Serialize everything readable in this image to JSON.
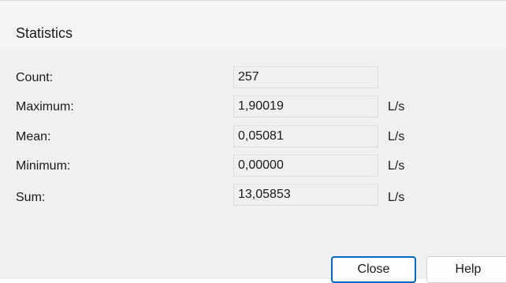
{
  "window": {
    "title": "Statistics"
  },
  "stats": [
    {
      "label": "Count:",
      "value": "257",
      "unit": ""
    },
    {
      "label": "Maximum:",
      "value": "1,90019",
      "unit": "L/s"
    },
    {
      "label": "Mean:",
      "value": "0,05081",
      "unit": "L/s"
    },
    {
      "label": "Minimum:",
      "value": "0,00000",
      "unit": "L/s"
    },
    {
      "label": "Sum:",
      "value": "13,05853",
      "unit": "L/s"
    }
  ],
  "buttons": {
    "close_label": "Close",
    "help_label": "Help"
  },
  "colors": {
    "accent": "#0067c0",
    "dialog_background": "#f0f0f0"
  }
}
